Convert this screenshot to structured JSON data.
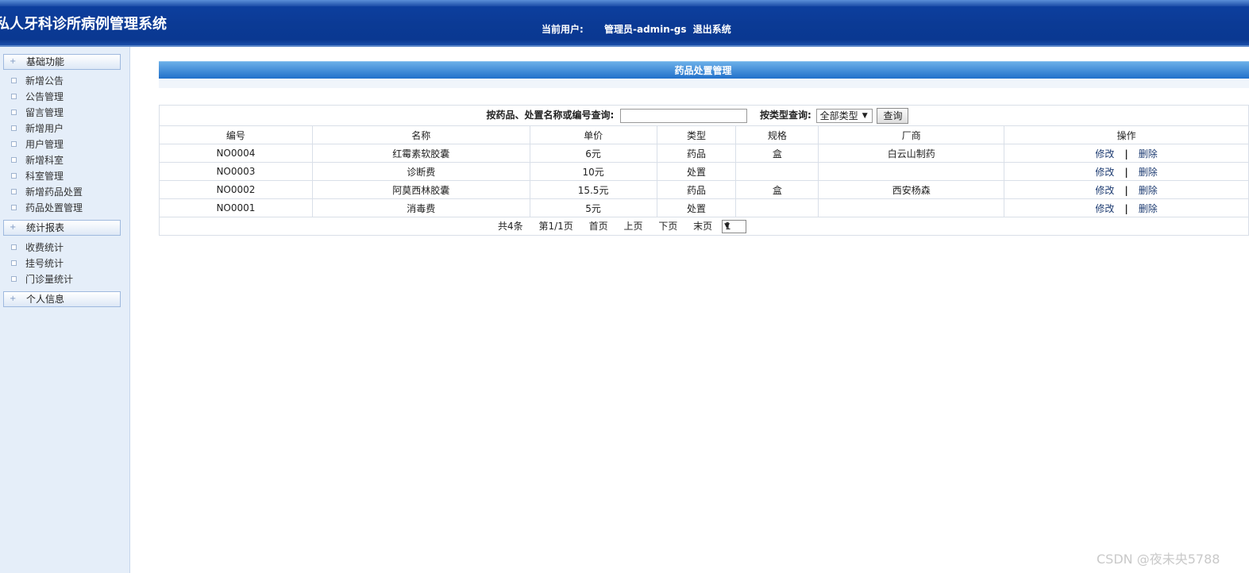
{
  "header": {
    "title": "私人牙科诊所病例管理系统",
    "current_user_label": "当前用户:",
    "user_name": "管理员-admin-gs",
    "logout": "退出系统"
  },
  "sidebar": {
    "groups": [
      {
        "title": "基础功能",
        "items": [
          "新增公告",
          "公告管理",
          "留言管理",
          "新增用户",
          "用户管理",
          "新增科室",
          "科室管理",
          "新增药品处置",
          "药品处置管理"
        ]
      },
      {
        "title": "统计报表",
        "items": [
          "收费统计",
          "挂号统计",
          "门诊量统计"
        ]
      },
      {
        "title": "个人信息",
        "items": []
      }
    ]
  },
  "main": {
    "panel_title": "药品处置管理",
    "search": {
      "name_label": "按药品、处置名称或编号查询:",
      "name_value": "",
      "type_label": "按类型查询:",
      "type_selected": "全部类型",
      "query_button": "查询"
    },
    "table": {
      "columns": [
        "编号",
        "名称",
        "单价",
        "类型",
        "规格",
        "厂商",
        "操作"
      ],
      "rows": [
        [
          "NO0004",
          "红霉素软胶囊",
          "6元",
          "药品",
          "盒",
          "白云山制药"
        ],
        [
          "NO0003",
          "诊断费",
          "10元",
          "处置",
          "",
          ""
        ],
        [
          "NO0002",
          "阿莫西林胶囊",
          "15.5元",
          "药品",
          "盒",
          "西安杨森"
        ],
        [
          "NO0001",
          "消毒费",
          "5元",
          "处置",
          "",
          ""
        ]
      ],
      "edit_label": "修改",
      "separator": "|",
      "delete_label": "删除"
    },
    "pager": {
      "total": "共4条",
      "page_info": "第1/1页",
      "first": "首页",
      "prev": "上页",
      "next": "下页",
      "last": "末页",
      "page_select": "1"
    }
  },
  "watermark": "CSDN @夜未央5788"
}
